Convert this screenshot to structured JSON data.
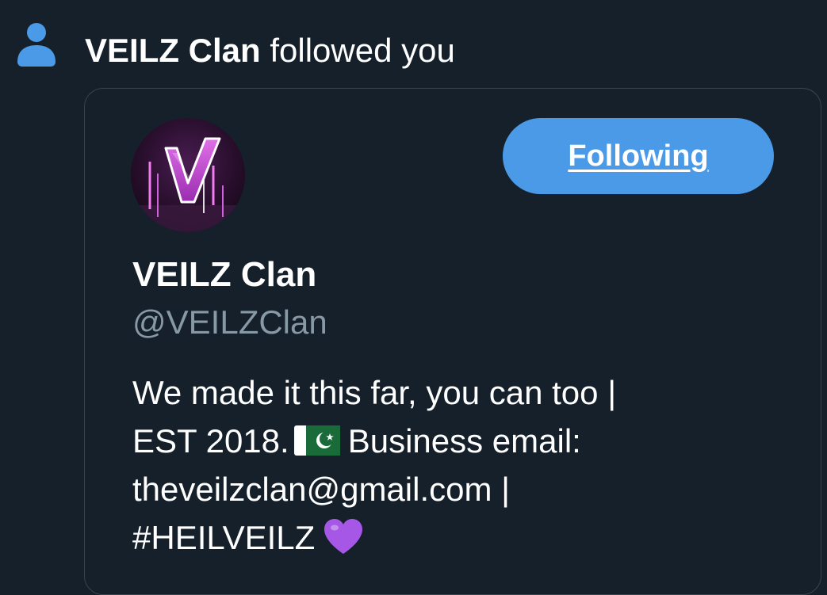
{
  "notification": {
    "icon": "person-icon",
    "actor_name": "VEILZ Clan",
    "action_text": " followed you"
  },
  "profile_card": {
    "avatar_icon": "veilz-logo-avatar",
    "follow_button_label": "Following",
    "display_name": "VEILZ Clan",
    "handle": "@VEILZClan",
    "bio": {
      "line1": "We made it this far, you can too |",
      "line2_start": "EST 2018.",
      "line2_flag_icon": "pakistan-flag-icon",
      "line2_end": "Business email:",
      "line3": "theveilzclan@gmail.com |",
      "line4": "#HEILVEILZ",
      "line4_emoji_icon": "purple-heart-icon"
    }
  },
  "colors": {
    "background": "#15202b",
    "accent": "#4a9ae8",
    "secondary_text": "#8899a6",
    "card_border": "#38444d"
  }
}
